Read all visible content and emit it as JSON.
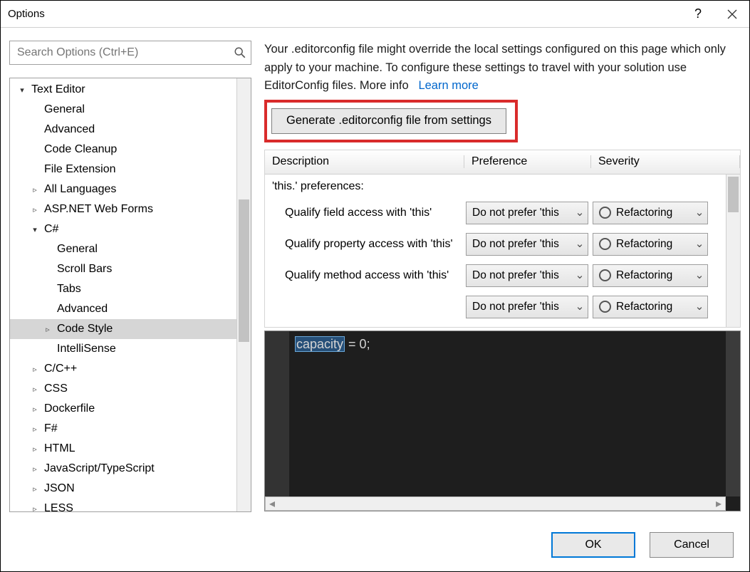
{
  "window": {
    "title": "Options"
  },
  "search": {
    "placeholder": "Search Options (Ctrl+E)"
  },
  "tree": [
    {
      "label": "Text Editor",
      "depth": 0,
      "expanded": true,
      "hasChildren": true
    },
    {
      "label": "General",
      "depth": 1,
      "hasChildren": false
    },
    {
      "label": "Advanced",
      "depth": 1,
      "hasChildren": false
    },
    {
      "label": "Code Cleanup",
      "depth": 1,
      "hasChildren": false
    },
    {
      "label": "File Extension",
      "depth": 1,
      "hasChildren": false
    },
    {
      "label": "All Languages",
      "depth": 1,
      "hasChildren": true,
      "expanded": false
    },
    {
      "label": "ASP.NET Web Forms",
      "depth": 1,
      "hasChildren": true,
      "expanded": false
    },
    {
      "label": "C#",
      "depth": 1,
      "hasChildren": true,
      "expanded": true
    },
    {
      "label": "General",
      "depth": 2,
      "hasChildren": false
    },
    {
      "label": "Scroll Bars",
      "depth": 2,
      "hasChildren": false
    },
    {
      "label": "Tabs",
      "depth": 2,
      "hasChildren": false
    },
    {
      "label": "Advanced",
      "depth": 2,
      "hasChildren": false
    },
    {
      "label": "Code Style",
      "depth": 2,
      "hasChildren": true,
      "expanded": false,
      "selected": true
    },
    {
      "label": "IntelliSense",
      "depth": 2,
      "hasChildren": false
    },
    {
      "label": "C/C++",
      "depth": 1,
      "hasChildren": true,
      "expanded": false
    },
    {
      "label": "CSS",
      "depth": 1,
      "hasChildren": true,
      "expanded": false
    },
    {
      "label": "Dockerfile",
      "depth": 1,
      "hasChildren": true,
      "expanded": false
    },
    {
      "label": "F#",
      "depth": 1,
      "hasChildren": true,
      "expanded": false
    },
    {
      "label": "HTML",
      "depth": 1,
      "hasChildren": true,
      "expanded": false
    },
    {
      "label": "JavaScript/TypeScript",
      "depth": 1,
      "hasChildren": true,
      "expanded": false
    },
    {
      "label": "JSON",
      "depth": 1,
      "hasChildren": true,
      "expanded": false
    },
    {
      "label": "LESS",
      "depth": 1,
      "hasChildren": true,
      "expanded": false
    }
  ],
  "info": {
    "text": "Your .editorconfig file might override the local settings configured on this page which only apply to your machine. To configure these settings to travel with your solution use EditorConfig files. More info",
    "link": "Learn more"
  },
  "generateButton": "Generate .editorconfig file from settings",
  "table": {
    "headers": {
      "desc": "Description",
      "pref": "Preference",
      "sev": "Severity"
    },
    "group": "'this.' preferences:",
    "rows": [
      {
        "desc": "Qualify field access with 'this'",
        "pref": "Do not prefer 'this",
        "sev": "Refactoring"
      },
      {
        "desc": "Qualify property access with 'this'",
        "pref": "Do not prefer 'this",
        "sev": "Refactoring"
      },
      {
        "desc": "Qualify method access with 'this'",
        "pref": "Do not prefer 'this",
        "sev": "Refactoring"
      },
      {
        "desc": "",
        "pref": "Do not prefer 'this",
        "sev": "Refactoring"
      }
    ]
  },
  "code": {
    "highlight": "capacity",
    "rest": " = 0;"
  },
  "footer": {
    "ok": "OK",
    "cancel": "Cancel"
  }
}
